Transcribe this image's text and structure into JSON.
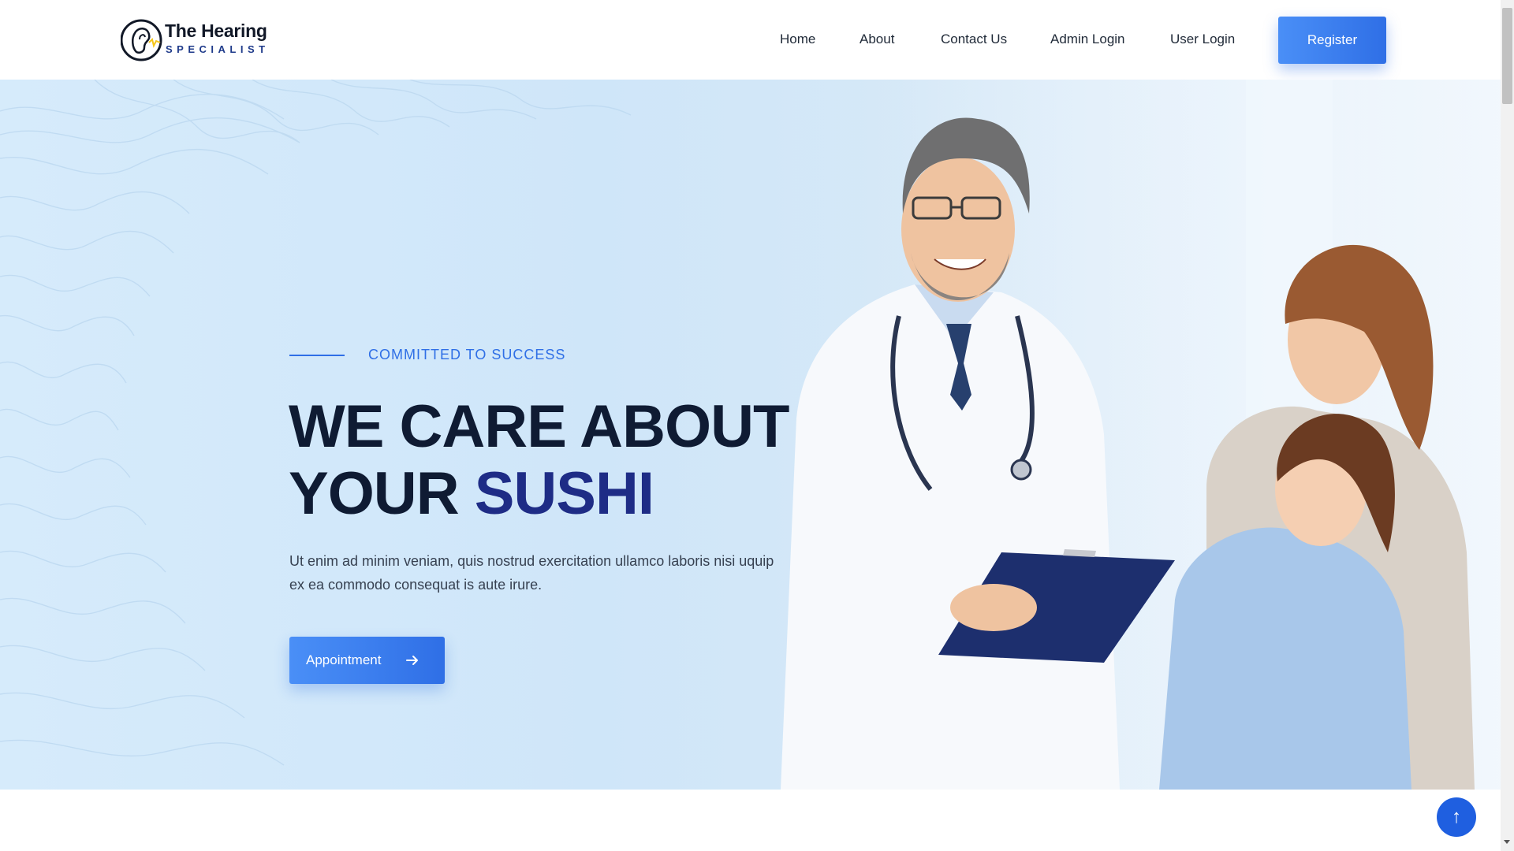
{
  "brand": {
    "title": "The Hearing",
    "subtitle": "SPECIALIST",
    "icon": "ear-logo-icon"
  },
  "nav": {
    "items": [
      {
        "label": "Home"
      },
      {
        "label": "About"
      },
      {
        "label": "Contact Us"
      },
      {
        "label": "Admin Login"
      },
      {
        "label": "User Login"
      }
    ],
    "register_label": "Register"
  },
  "hero": {
    "tagline": "COMMITTED TO SUCCESS",
    "headline_line1": "WE CARE ABOUT",
    "headline_line2_prefix": "YOUR",
    "headline_accent": "SUSHI",
    "description": "Ut enim ad minim veniam, quis nostrud exercitation ullamco laboris nisi uquip ex ea commodo consequat is aute irure.",
    "cta_label": "Appointment",
    "cta_icon": "arrow-right-icon",
    "image": "doctor-with-mother-and-daughter-photo"
  },
  "back_to_top": {
    "icon": "arrow-up-icon",
    "glyph": "↑"
  },
  "colors": {
    "accent": "#2f6fe6",
    "heading": "#0f1b33",
    "headline_accent": "#1e2c86",
    "hero_bg": "#d3e8fa"
  }
}
